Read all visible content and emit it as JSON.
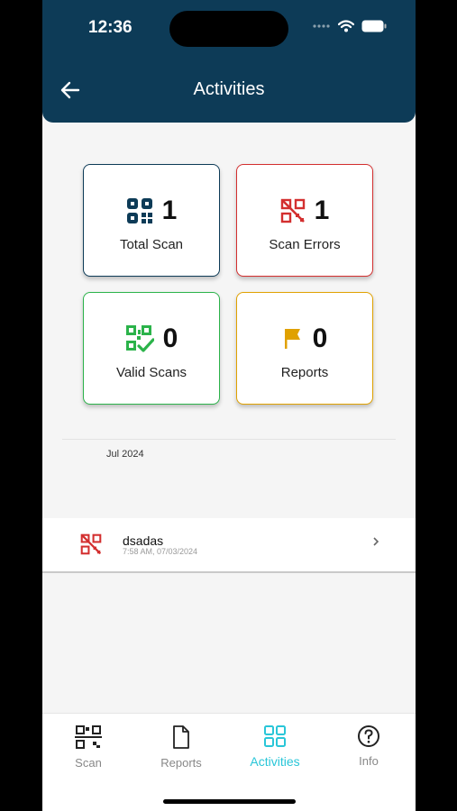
{
  "status_bar": {
    "time": "12:36"
  },
  "header": {
    "title": "Activities"
  },
  "stats": [
    {
      "value": "1",
      "label": "Total Scan",
      "color": "#0d3b57"
    },
    {
      "value": "1",
      "label": "Scan Errors",
      "color": "#d32f2f"
    },
    {
      "value": "0",
      "label": "Valid Scans",
      "color": "#2bb34a"
    },
    {
      "value": "0",
      "label": "Reports",
      "color": "#e0a100"
    }
  ],
  "activity": {
    "month": "Jul 2024",
    "items": [
      {
        "name": "dsadas",
        "datetime": "7:58 AM, 07/03/2024",
        "icon": "scan-error-icon"
      }
    ]
  },
  "tabs": [
    {
      "label": "Scan",
      "icon": "qr-scan-icon"
    },
    {
      "label": "Reports",
      "icon": "document-icon"
    },
    {
      "label": "Activities",
      "icon": "grid-icon",
      "active": true
    },
    {
      "label": "Info",
      "icon": "help-circle-icon"
    }
  ],
  "colors": {
    "header": "#0d3b57",
    "accent": "#29c6d8"
  }
}
